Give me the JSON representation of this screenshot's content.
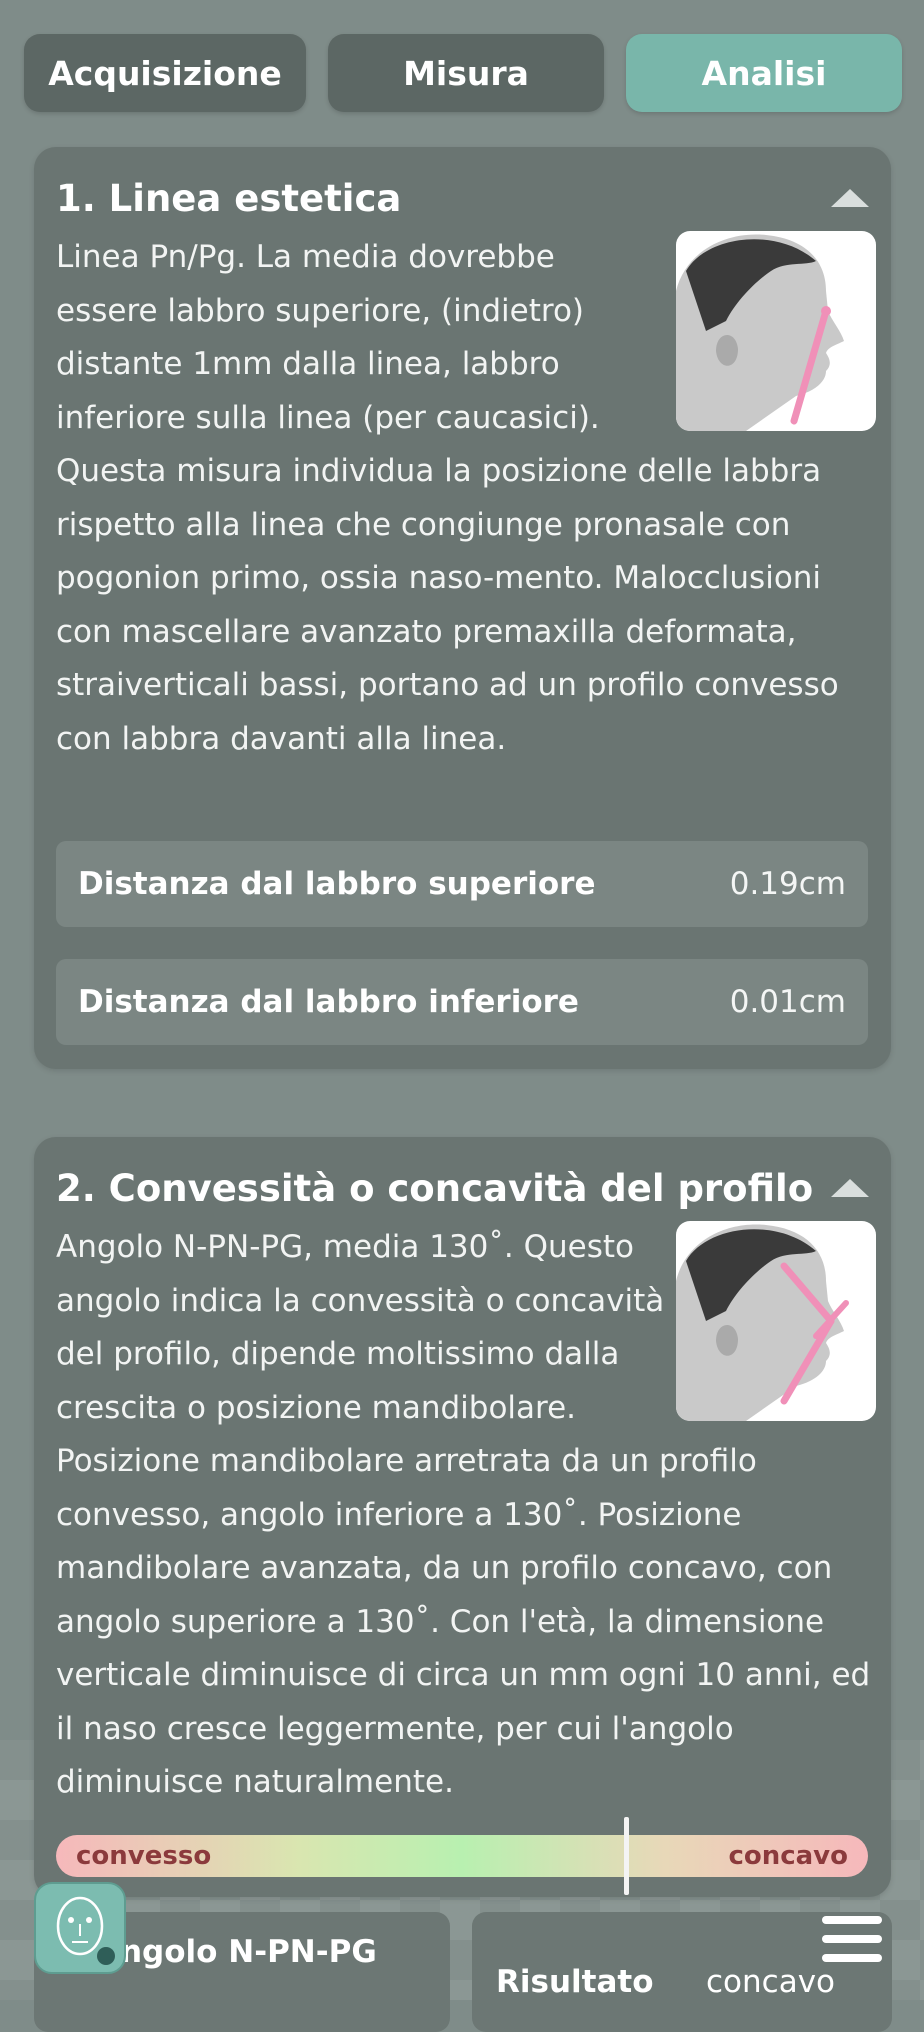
{
  "tabs": [
    {
      "label": "Acquisizione",
      "active": false
    },
    {
      "label": "Misura",
      "active": false
    },
    {
      "label": "Analisi",
      "active": true
    }
  ],
  "sections": [
    {
      "title": "1. Linea estetica",
      "description": "Linea Pn/Pg. La media dovrebbe essere labbro superiore, (indietro) distante 1mm dalla linea, labbro inferiore sulla linea (per caucasici). Questa misura individua la posizione delle labbra rispetto alla linea che congiunge pronasale con pogonion primo, ossia naso-mento. Malocclusioni con mascellare avanzato premaxilla deformata, straiverticali bassi, portano ad un profilo convesso con labbra davanti alla linea.",
      "image_icon": "face-profile-line-icon",
      "measures": [
        {
          "label": "Distanza dal labbro superiore",
          "value": "0.19cm"
        },
        {
          "label": "Distanza dal labbro inferiore",
          "value": "0.01cm"
        }
      ]
    },
    {
      "title": "2. Convessità o concavità del profilo",
      "description": "Angolo N-PN-PG, media 130˚. Questo angolo indica la convessità o concavità del profilo, dipende moltissimo dalla crescita o posizione mandibolare. Posizione mandibolare arretrata da un profilo convesso, angolo inferiore a 130˚. Posizione mandibolare avanzata, da un profilo concavo, con angolo superiore a 130˚. Con l'età, la dimensione verticale diminuisce di circa un mm ogni 10 anni, ed il naso cresce leggermente, per cui l'angolo diminuisce naturalmente.",
      "image_icon": "face-profile-angle-icon",
      "scale": {
        "left_label": "convesso",
        "right_label": "concavo",
        "marker_fraction": 0.7
      }
    }
  ],
  "bottom": {
    "angle_label": "Angolo N-PN-PG",
    "result_label": "Risultato",
    "result_value": "concavo"
  },
  "colors": {
    "accent": "#79b6aa",
    "card": "#6a7572",
    "tab": "#5c6764"
  }
}
